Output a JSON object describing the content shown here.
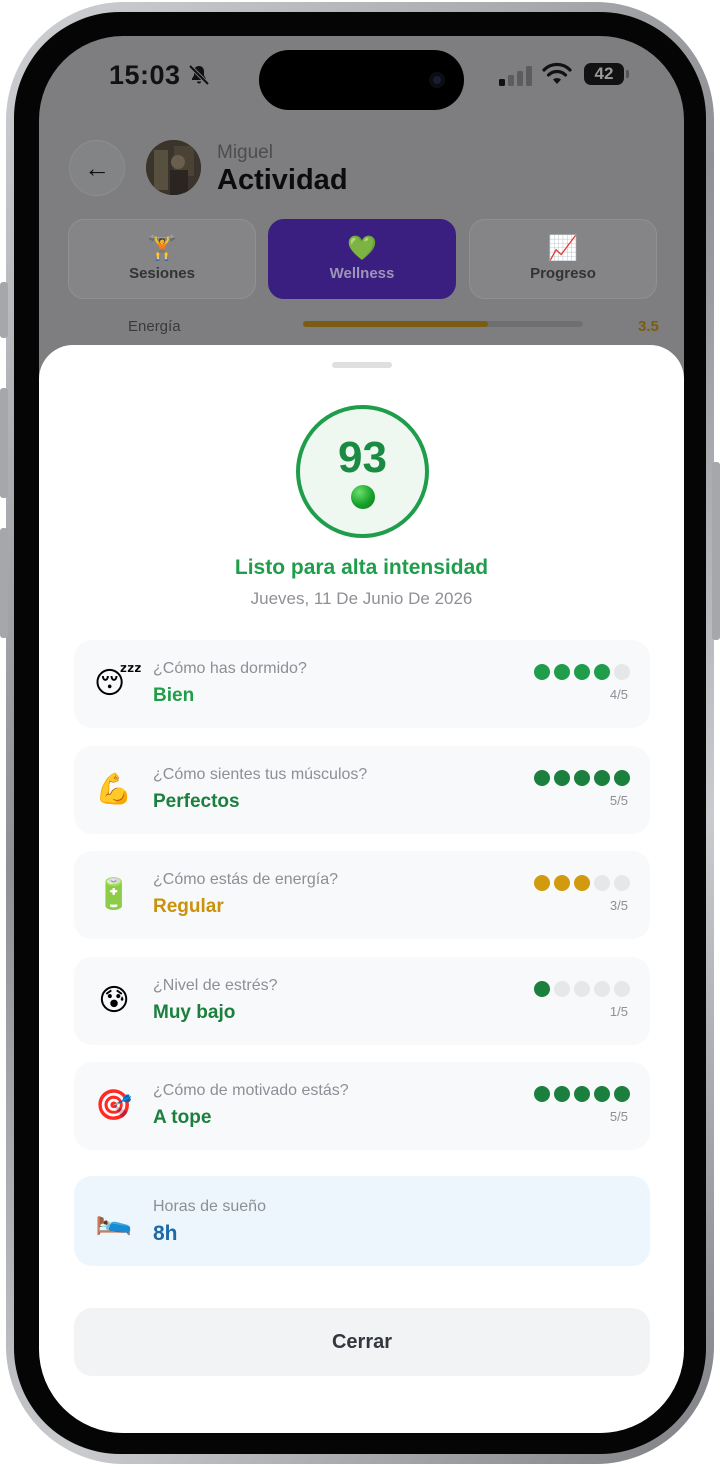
{
  "status_bar": {
    "time": "15:03",
    "battery": "42",
    "icons": [
      "bell-slash-icon",
      "signal-icon",
      "wifi-icon",
      "battery-icon"
    ]
  },
  "header": {
    "user_name": "Miguel",
    "title": "Actividad",
    "back_icon": "←"
  },
  "tabs": [
    {
      "label": "Sesiones",
      "icon": "🏋️",
      "icon_name": "weightlifter-icon",
      "active": false
    },
    {
      "label": "Wellness",
      "icon": "💚",
      "icon_name": "green-heart-icon",
      "active": true
    },
    {
      "label": "Progreso",
      "icon": "📈",
      "icon_name": "chart-up-icon",
      "active": false
    }
  ],
  "background_row": {
    "label": "Energía",
    "value": "3.5",
    "fill_fraction": 0.66
  },
  "sheet": {
    "score": "93",
    "readiness_label": "Listo para alta intensidad",
    "date": "Jueves, 11 De Junio De 2026",
    "items": [
      {
        "question": "¿Cómo has dormido?",
        "answer": "Bien",
        "emoji": "😴",
        "icon_name": "sleeping-face-icon",
        "score": 4,
        "max": 5,
        "score_text": "4/5",
        "color": "#1f9d4b",
        "answer_color": "#1f9d4b"
      },
      {
        "question": "¿Cómo sientes tus músculos?",
        "answer": "Perfectos",
        "emoji": "💪",
        "icon_name": "flexed-biceps-icon",
        "score": 5,
        "max": 5,
        "score_text": "5/5",
        "color": "#1b7f3e",
        "answer_color": "#1b7f3e"
      },
      {
        "question": "¿Cómo estás de energía?",
        "answer": "Regular",
        "emoji": "🔋",
        "icon_name": "battery-icon",
        "score": 3,
        "max": 5,
        "score_text": "3/5",
        "color": "#d19a0f",
        "answer_color": "#c9920a"
      },
      {
        "question": "¿Nivel de estrés?",
        "answer": "Muy bajo",
        "emoji": "😰",
        "icon_name": "anxious-face-icon",
        "score": 1,
        "max": 5,
        "score_text": "1/5",
        "color": "#1b7f3e",
        "answer_color": "#1b7f3e"
      },
      {
        "question": "¿Cómo de motivado estás?",
        "answer": "A tope",
        "emoji": "🎯",
        "icon_name": "target-icon",
        "score": 5,
        "max": 5,
        "score_text": "5/5",
        "color": "#1b7f3e",
        "answer_color": "#1b7f3e"
      }
    ],
    "sleep": {
      "label": "Horas de sueño",
      "value": "8h",
      "emoji": "🛌",
      "icon_name": "bed-icon"
    },
    "close_label": "Cerrar"
  }
}
